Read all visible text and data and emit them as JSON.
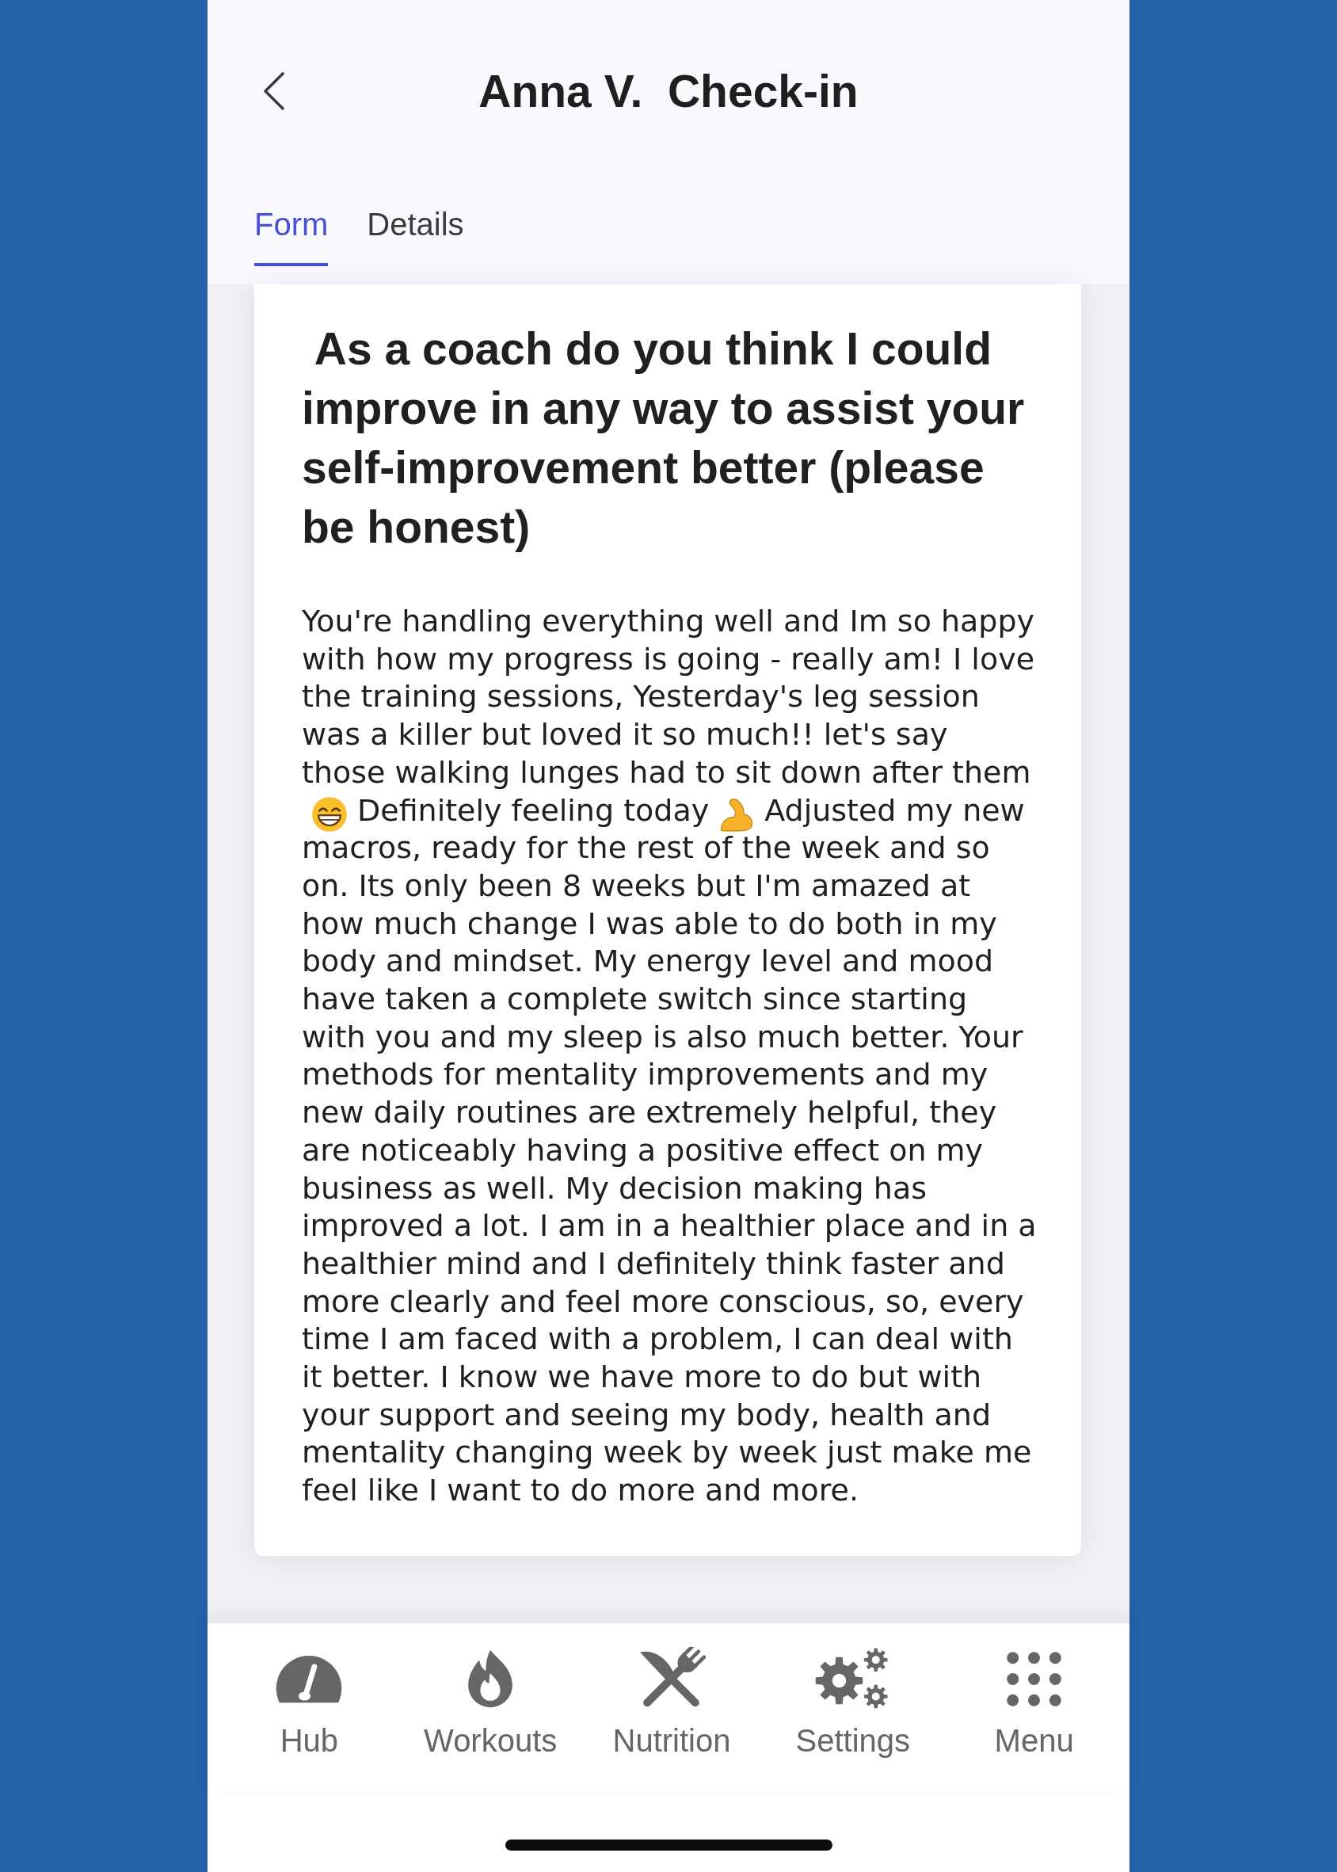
{
  "header": {
    "title": "Anna V.  Check-in"
  },
  "tabs": [
    {
      "label": "Form",
      "selected": true
    },
    {
      "label": "Details",
      "selected": false
    }
  ],
  "question": {
    "title": " As a coach do you think I could improve in any way to assist your self-improvement better (please be honest)",
    "answer": [
      {
        "kind": "text",
        "text": "You're handling everything well and Im so happy with how my progress is going - really am! I love the training sessions, Yesterday's leg session was a killer but loved it so much!! let's say those walking lunges had to sit down after them"
      },
      {
        "kind": "grin"
      },
      {
        "kind": "text",
        "text": "Definitely feeling today"
      },
      {
        "kind": "flex"
      },
      {
        "kind": "text",
        "text": "Adjusted my new macros, ready for the rest of the week and so on. Its only been 8 weeks but I'm amazed at how much change I was able to do both in my body and mindset. My energy level and mood have taken a complete switch since starting with you and my sleep is also much better. Your methods for mentality improvements and my new daily routines are extremely helpful, they are noticeably having a positive effect on my business as well. My decision making has improved a lot. I am in a healthier place and in a healthier mind and I definitely think faster and more clearly and feel more conscious, so, every time I am faced with a problem, I can deal with it better. I know we have more to do but with your support and seeing my body, health and mentality changing week by week just make me feel like I want to do more and more."
      }
    ]
  },
  "nav": [
    {
      "label": "Hub"
    },
    {
      "label": "Workouts"
    },
    {
      "label": "Nutrition"
    },
    {
      "label": "Settings"
    },
    {
      "label": "Menu"
    }
  ]
}
